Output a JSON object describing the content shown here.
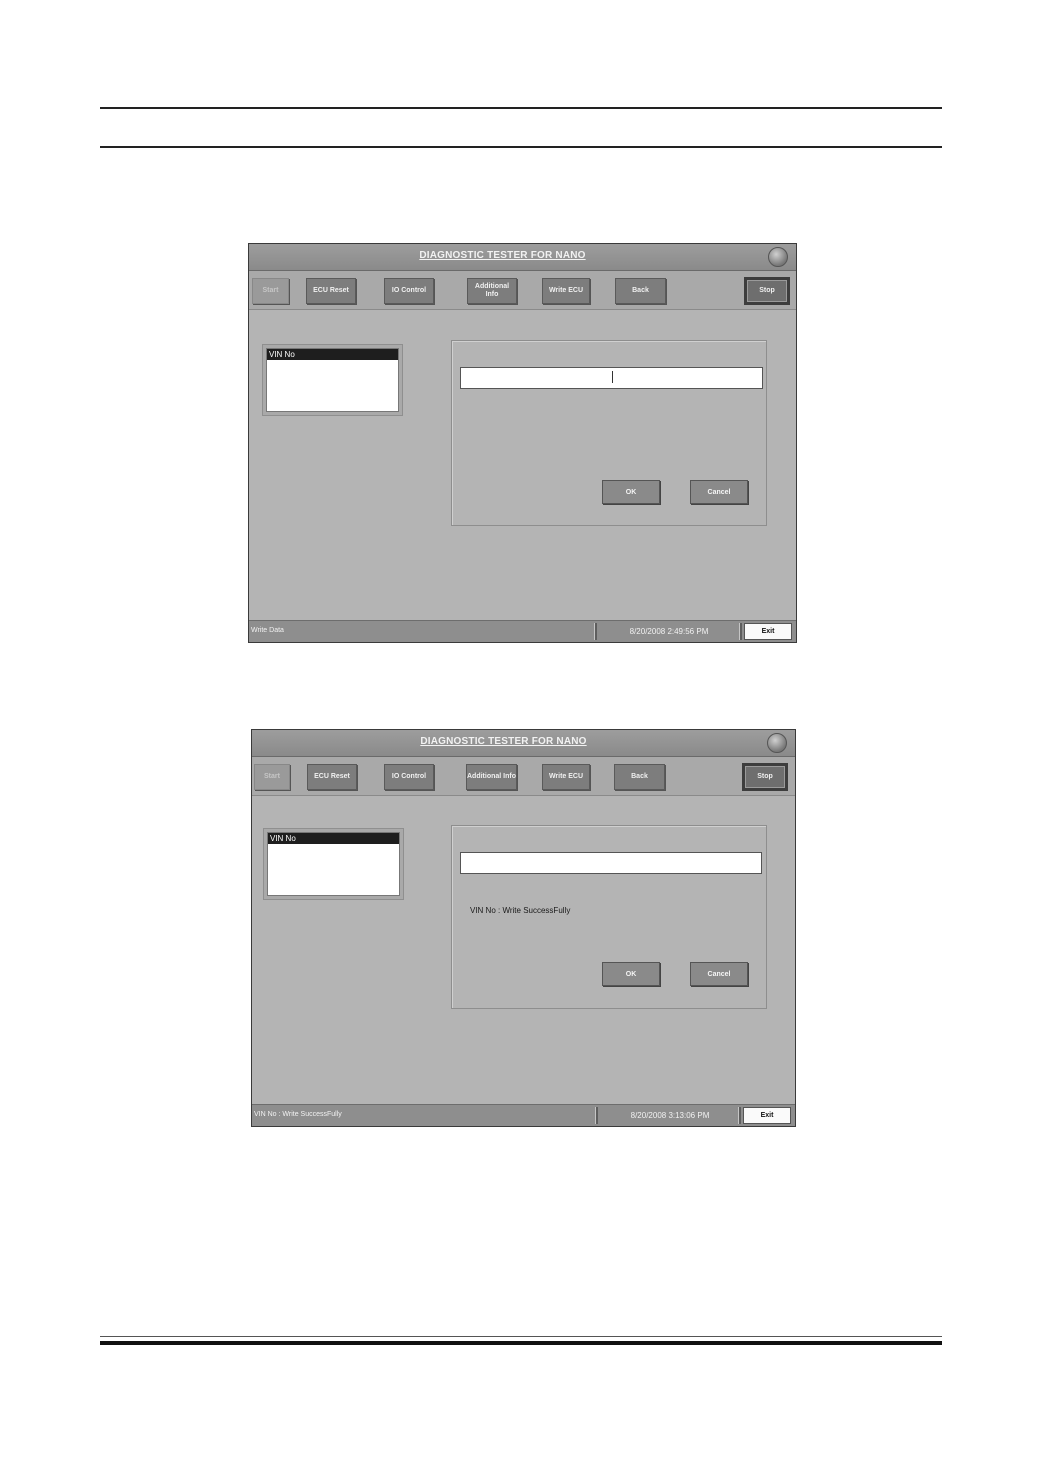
{
  "app": {
    "title": "DIAGNOSTIC TESTER  FOR NANO",
    "toolbar": {
      "start": "Start",
      "ecu_reset": "ECU Reset",
      "io_control": "IO Control",
      "additional_info": "Additional Info",
      "write_ecu": "Write ECU",
      "back": "Back",
      "stop": "Stop"
    },
    "list_item": "VIN No",
    "ok": "OK",
    "cancel": "Cancel",
    "exit": "Exit"
  },
  "screens": [
    {
      "vin_value": "",
      "message": "",
      "status_text": "Write Data",
      "datetime": "8/20/2008 2:49:56 PM"
    },
    {
      "vin_value": "",
      "message": "VIN No : Write SuccessFully",
      "status_text": "VIN No : Write SuccessFully",
      "datetime": "8/20/2008 3:13:06 PM"
    }
  ]
}
